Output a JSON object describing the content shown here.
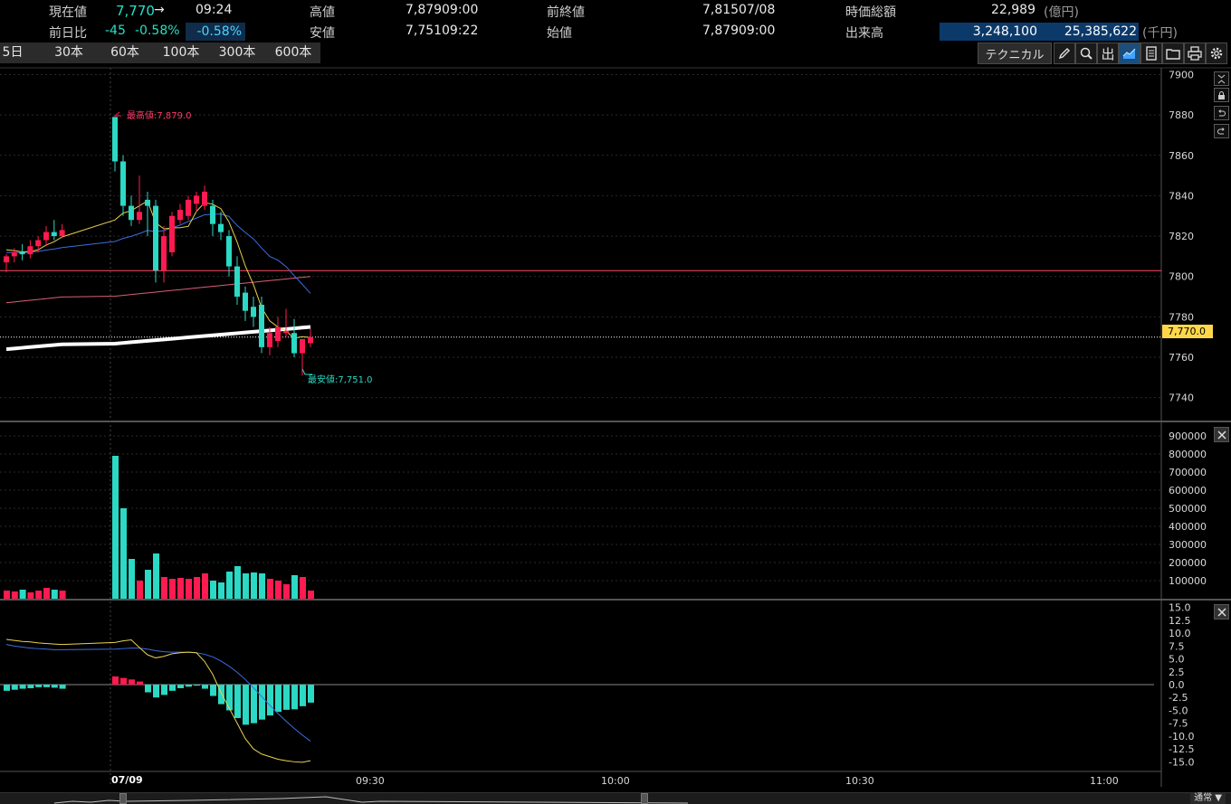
{
  "header": {
    "current_price_label": "現在値",
    "current_price": "7,770",
    "trend_arrow": "→",
    "current_time": "09:24",
    "change_label": "前日比",
    "change_value": "-45",
    "change_pct": "-0.58%",
    "change_pct_highlight": "-0.58%",
    "high_label": "高値",
    "high_value": "7,879",
    "high_time": "09:00",
    "low_label": "安値",
    "low_value": "7,751",
    "low_time": "09:22",
    "prev_close_label": "前終値",
    "prev_close_value": "7,815",
    "prev_close_date": "07/08",
    "open_label": "始値",
    "open_value": "7,879",
    "open_time": "09:00",
    "market_cap_label": "時価総額",
    "market_cap_value": "22,989",
    "market_cap_unit": "(億円)",
    "volume_label": "出来高",
    "volume_value": "3,248,100",
    "turnover_value": "25,385,622",
    "turnover_unit": "(千円)"
  },
  "tabs": [
    "5日",
    "30本",
    "60本",
    "100本",
    "300本",
    "600本"
  ],
  "toolbar": {
    "technical_label": "テクニカル",
    "icons": [
      "pencil-icon",
      "search-zoom-icon",
      "output-icon",
      "chart-type-icon",
      "document-icon",
      "folder-icon",
      "print-icon",
      "gear-icon"
    ]
  },
  "side_icons": [
    "fit-icon",
    "lock-icon",
    "undo-icon",
    "redo-icon"
  ],
  "colors": {
    "up": "#ff1a50",
    "down": "#2bd9c4",
    "ma5": "#e8d34a",
    "ma25": "#3c6de0",
    "ma75": "#d9607a",
    "ma200": "#ffffff",
    "prev_close_line": "#ff4d6a",
    "current_line": "#ffffff",
    "price_tag": "#ffd84a"
  },
  "annotations": {
    "high": "最高値:7,879.0",
    "low": "最安値:7,751.0"
  },
  "price_tag": "7,770.0",
  "bottom": {
    "dropdown_label": "通常"
  },
  "chart_data": [
    {
      "type": "candlestick",
      "interval": "1 minute",
      "ylim": [
        7730,
        7902
      ],
      "yticks": [
        "7900",
        "7880",
        "7860",
        "7840",
        "7820",
        "7800",
        "7780",
        "7760",
        "7740"
      ],
      "reference_lines": {
        "prev_close": 7815,
        "current": 7770
      },
      "candles": [
        {
          "o": 7807,
          "h": 7811,
          "l": 7802,
          "c": 7810
        },
        {
          "o": 7810,
          "h": 7814,
          "l": 7807,
          "c": 7812
        },
        {
          "o": 7812,
          "h": 7816,
          "l": 7808,
          "c": 7811
        },
        {
          "o": 7811,
          "h": 7818,
          "l": 7809,
          "c": 7815
        },
        {
          "o": 7815,
          "h": 7820,
          "l": 7812,
          "c": 7818
        },
        {
          "o": 7818,
          "h": 7825,
          "l": 7815,
          "c": 7822
        },
        {
          "o": 7822,
          "h": 7828,
          "l": 7818,
          "c": 7820
        },
        {
          "o": 7820,
          "h": 7826,
          "l": 7819,
          "c": 7823
        },
        {
          "o": 7879,
          "h": 7879,
          "l": 7852,
          "c": 7857
        },
        {
          "o": 7857,
          "h": 7860,
          "l": 7830,
          "c": 7835
        },
        {
          "o": 7835,
          "h": 7840,
          "l": 7825,
          "c": 7828
        },
        {
          "o": 7828,
          "h": 7850,
          "l": 7826,
          "c": 7832
        },
        {
          "o": 7838,
          "h": 7842,
          "l": 7820,
          "c": 7835
        },
        {
          "o": 7835,
          "h": 7838,
          "l": 7797,
          "c": 7803
        },
        {
          "o": 7803,
          "h": 7825,
          "l": 7797,
          "c": 7820
        },
        {
          "o": 7812,
          "h": 7832,
          "l": 7810,
          "c": 7830
        },
        {
          "o": 7828,
          "h": 7836,
          "l": 7826,
          "c": 7833
        },
        {
          "o": 7830,
          "h": 7840,
          "l": 7828,
          "c": 7838
        },
        {
          "o": 7836,
          "h": 7842,
          "l": 7832,
          "c": 7840
        },
        {
          "o": 7835,
          "h": 7845,
          "l": 7833,
          "c": 7842
        },
        {
          "o": 7835,
          "h": 7838,
          "l": 7820,
          "c": 7826
        },
        {
          "o": 7826,
          "h": 7832,
          "l": 7818,
          "c": 7822
        },
        {
          "o": 7820,
          "h": 7823,
          "l": 7800,
          "c": 7805
        },
        {
          "o": 7805,
          "h": 7810,
          "l": 7786,
          "c": 7790
        },
        {
          "o": 7792,
          "h": 7795,
          "l": 7778,
          "c": 7783
        },
        {
          "o": 7785,
          "h": 7790,
          "l": 7775,
          "c": 7780
        },
        {
          "o": 7786,
          "h": 7790,
          "l": 7762,
          "c": 7765
        },
        {
          "o": 7765,
          "h": 7775,
          "l": 7761,
          "c": 7772
        },
        {
          "o": 7768,
          "h": 7780,
          "l": 7765,
          "c": 7775
        },
        {
          "o": 7772,
          "h": 7784,
          "l": 7770,
          "c": 7773
        },
        {
          "o": 7772,
          "h": 7779,
          "l": 7760,
          "c": 7762
        },
        {
          "o": 7762,
          "h": 7768,
          "l": 7751,
          "c": 7769
        },
        {
          "o": 7767,
          "h": 7774,
          "l": 7765,
          "c": 7770
        }
      ]
    },
    {
      "type": "bar",
      "name": "volume",
      "ylim": [
        0,
        950000
      ],
      "yticks": [
        "900000",
        "800000",
        "700000",
        "600000",
        "500000",
        "400000",
        "300000",
        "200000",
        "100000"
      ],
      "values": [
        45000,
        40000,
        50000,
        35000,
        45000,
        60000,
        50000,
        45000,
        790000,
        500000,
        220000,
        100000,
        160000,
        250000,
        120000,
        110000,
        115000,
        110000,
        120000,
        140000,
        100000,
        90000,
        150000,
        180000,
        140000,
        145000,
        140000,
        110000,
        100000,
        80000,
        130000,
        120000,
        45000
      ]
    },
    {
      "type": "line",
      "name": "macd",
      "ylim": [
        -16,
        16
      ],
      "yticks": [
        "15.0",
        "12.5",
        "10.0",
        "7.5",
        "5.0",
        "2.5",
        "0.0",
        "-2.5",
        "-5.0",
        "-7.5",
        "-10.0",
        "-12.5",
        "-15.0"
      ],
      "histogram": [
        -1.2,
        -1.0,
        -0.8,
        -0.7,
        -0.5,
        -0.5,
        -0.6,
        -0.8,
        1.6,
        1.3,
        1.0,
        0.6,
        -1.5,
        -2.5,
        -2.0,
        -1.2,
        -0.7,
        -0.4,
        -0.2,
        -0.8,
        -2.2,
        -3.8,
        -5.0,
        -6.5,
        -7.8,
        -7.5,
        -6.8,
        -6.0,
        -5.3,
        -4.9,
        -4.8,
        -4.2,
        -3.5
      ],
      "macd_line": [
        8.8,
        8.6,
        8.4,
        8.3,
        8.1,
        8.0,
        7.9,
        7.8,
        8.2,
        8.5,
        8.7,
        7.2,
        5.8,
        5.2,
        5.5,
        6.0,
        6.2,
        6.3,
        6.2,
        4.5,
        2.0,
        -1.5,
        -4.5,
        -7.5,
        -10.5,
        -12.5,
        -13.5,
        -14.0,
        -14.5,
        -14.8,
        -15.0,
        -15.1,
        -14.8
      ],
      "signal_line": [
        7.8,
        7.5,
        7.3,
        7.1,
        7.0,
        6.9,
        6.8,
        6.8,
        6.9,
        7.0,
        7.1,
        7.1,
        6.9,
        6.6,
        6.4,
        6.3,
        6.3,
        6.3,
        6.2,
        5.9,
        5.4,
        4.6,
        3.6,
        2.4,
        1.0,
        -0.6,
        -2.3,
        -4.0,
        -5.6,
        -7.1,
        -8.5,
        -9.8,
        -11.0
      ]
    }
  ],
  "xaxis": {
    "date_label": "07/09",
    "time_ticks": [
      "09:30",
      "10:00",
      "10:30",
      "11:00"
    ]
  }
}
